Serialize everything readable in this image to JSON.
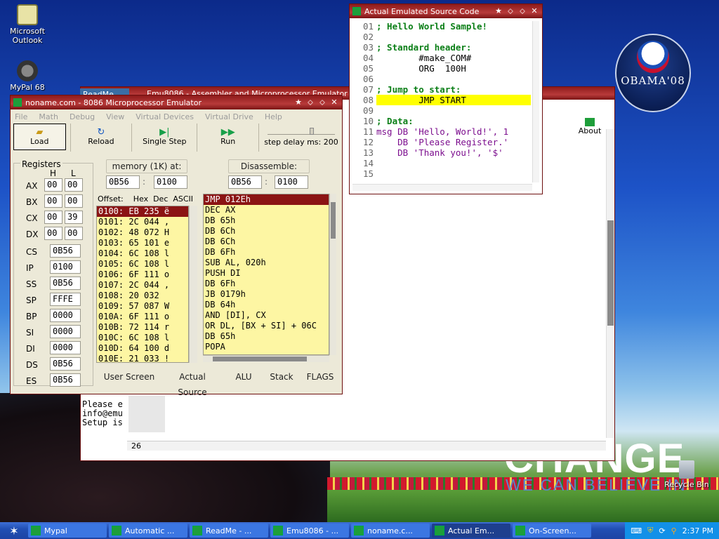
{
  "desktop": {
    "icons": [
      {
        "label": "Microsoft Outlook",
        "icon": "outlook-icon"
      },
      {
        "label": "MyPal 68",
        "icon": "mypal-icon"
      }
    ],
    "recycle_bin": "Recycle Bin",
    "poster": {
      "obama": "OBAMA'08",
      "change": "CHANGE",
      "believe": "WE CAN BELIEVE IN"
    }
  },
  "source_window": {
    "title": "Actual Emulated Source Code",
    "lines": [
      {
        "n": "01",
        "t": "; Hello World Sample!",
        "c": "cmt"
      },
      {
        "n": "02",
        "t": "",
        "c": ""
      },
      {
        "n": "03",
        "t": "; Standard header:",
        "c": "cmt"
      },
      {
        "n": "04",
        "t": "        #make_COM#",
        "c": "dir"
      },
      {
        "n": "05",
        "t": "        ORG  100H",
        "c": "dir"
      },
      {
        "n": "06",
        "t": "",
        "c": ""
      },
      {
        "n": "07",
        "t": "; Jump to start:",
        "c": "cmt"
      },
      {
        "n": "08",
        "t": "        JMP START",
        "c": "hl"
      },
      {
        "n": "09",
        "t": "",
        "c": ""
      },
      {
        "n": "10",
        "t": "; Data:",
        "c": "cmt"
      },
      {
        "n": "11",
        "t": "msg DB 'Hello, World!', 1",
        "c": "str"
      },
      {
        "n": "12",
        "t": "    DB 'Please Register.'",
        "c": "str"
      },
      {
        "n": "13",
        "t": "    DB 'Thank you!', '$'",
        "c": "str"
      },
      {
        "n": "14",
        "t": "",
        "c": ""
      },
      {
        "n": "15",
        "t": "",
        "c": ""
      }
    ]
  },
  "back_window": {
    "title": "Emu8086 - Assembler and Microprocessor Emulator v2.57",
    "about": "About",
    "line_col": "26",
    "text_lines": [
      "Please e",
      "info@emu",
      "",
      "Setup is"
    ]
  },
  "readme_tab": "ReadMe",
  "emulator": {
    "title": "noname.com - 8086 Microprocessor Emulator",
    "menu": [
      "File",
      "Math",
      "Debug",
      "View",
      "Virtual Devices",
      "Virtual Drive",
      "Help"
    ],
    "toolbar": {
      "load": "Load",
      "reload": "Reload",
      "single_step": "Single Step",
      "run": "Run",
      "step_delay": "step delay ms: 200"
    },
    "registers_label": "Registers",
    "h": "H",
    "l": "L",
    "regs8": [
      {
        "name": "AX",
        "h": "00",
        "l": "00"
      },
      {
        "name": "BX",
        "h": "00",
        "l": "00"
      },
      {
        "name": "CX",
        "h": "00",
        "l": "39"
      },
      {
        "name": "DX",
        "h": "00",
        "l": "00"
      }
    ],
    "regs16": [
      {
        "name": "CS",
        "v": "0B56"
      },
      {
        "name": "IP",
        "v": "0100"
      },
      {
        "name": "SS",
        "v": "0B56"
      },
      {
        "name": "SP",
        "v": "FFFE"
      },
      {
        "name": "BP",
        "v": "0000"
      },
      {
        "name": "SI",
        "v": "0000"
      },
      {
        "name": "DI",
        "v": "0000"
      },
      {
        "name": "DS",
        "v": "0B56"
      },
      {
        "name": "ES",
        "v": "0B56"
      }
    ],
    "memory_label": "memory (1K) at:",
    "mem_seg": "0B56",
    "mem_off": "0100",
    "disasm_label": "Disassemble:",
    "dis_seg": "0B56",
    "dis_off": "0100",
    "mem_cols": "Offset:    Hex  Dec  ASCII",
    "memory": [
      "0100: EB 235 ë",
      "0101: 2C 044 ,",
      "0102: 48 072 H",
      "0103: 65 101 e",
      "0104: 6C 108 l",
      "0105: 6C 108 l",
      "0106: 6F 111 o",
      "0107: 2C 044 ,",
      "0108: 20 032  ",
      "0109: 57 087 W",
      "010A: 6F 111 o",
      "010B: 72 114 r",
      "010C: 6C 108 l",
      "010D: 64 100 d",
      "010E: 21 033 !"
    ],
    "disasm": [
      "JMP 012Eh",
      "DEC AX",
      "DB 65h",
      "DB 6Ch",
      "DB 6Ch",
      "DB 6Fh",
      "SUB AL, 020h",
      "PUSH DI",
      "DB 6Fh",
      "JB 0179h",
      "DB 64h",
      "AND [DI], CX",
      "OR DL, [BX + SI] + 06C",
      "DB 65h",
      "POPA"
    ],
    "bottom_buttons": [
      "User Screen",
      "Actual Source",
      "ALU",
      "Stack",
      "FLAGS"
    ]
  },
  "taskbar": {
    "items": [
      "Mypal",
      "Automatic ...",
      "ReadMe - ...",
      "Emu8086 - ...",
      "noname.c...",
      "Actual Em...",
      "On-Screen..."
    ],
    "active_index": 5,
    "time": "2:37 PM"
  }
}
